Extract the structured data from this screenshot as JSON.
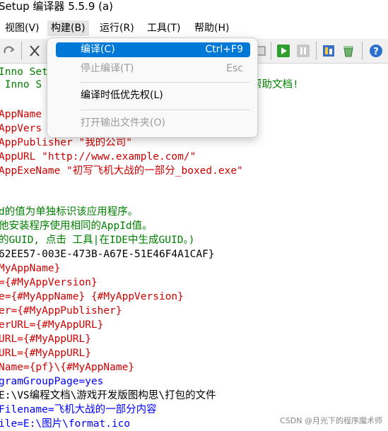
{
  "window": {
    "title": "Setup 编译器 5.5.9 (a)"
  },
  "menubar": [
    {
      "label": "视图(V)"
    },
    {
      "label": "构建(B)"
    },
    {
      "label": "运行(R)"
    },
    {
      "label": "工具(T)"
    },
    {
      "label": "帮助(H)"
    }
  ],
  "build_menu": {
    "items": [
      {
        "label": "编译(C)",
        "shortcut": "Ctrl+F9"
      },
      {
        "label": "停止编译(T)",
        "shortcut": "Esc"
      },
      {
        "label": "编译时低优先权(L)"
      },
      {
        "label": "打开输出文件夹(O)"
      }
    ]
  },
  "editor": {
    "lines": [
      {
        "text": "Inno Set"
      },
      {
        "text": " Inno S",
        "suffix": "帮助文档!"
      },
      {
        "text": ""
      },
      {
        "text": "AppName"
      },
      {
        "text": "AppVers"
      },
      {
        "text": "AppPublisher \"我的公司\""
      },
      {
        "text": "AppURL \"http://www.example.com/\""
      },
      {
        "text": "AppExeName \"初写飞机大战的一部分_boxed.exe\""
      },
      {
        "text": ""
      },
      {
        "text": ""
      },
      {
        "text": "d的值为单独标识该应用程序。"
      },
      {
        "text": "他安装程序使用相同的AppId值。"
      },
      {
        "text": "的GUID, 点击 工具|在IDE中生成GUID。)"
      },
      {
        "text": "62EE57-003E-473B-A67E-51E46F4A1CAF}"
      },
      {
        "text": "MyAppName}"
      },
      {
        "text": "={#MyAppVersion}"
      },
      {
        "text": "e={#MyAppName} {#MyAppVersion}"
      },
      {
        "text": "er={#MyAppPublisher}"
      },
      {
        "text": "erURL={#MyAppURL}"
      },
      {
        "text": "URL={#MyAppURL}"
      },
      {
        "text": "URL={#MyAppURL}"
      },
      {
        "text": "Name={pf}\\{#MyAppName}"
      },
      {
        "text": "gramGroupPage=yes"
      },
      {
        "text": "E:\\VS编程文档\\游戏开发版图构思\\打包的文件"
      },
      {
        "text": "Filename=飞机大战的一部分内容"
      },
      {
        "text": "ile=E:\\图片\\format.ico"
      }
    ]
  },
  "watermark": "CSDN @月光下的程序魔术师"
}
